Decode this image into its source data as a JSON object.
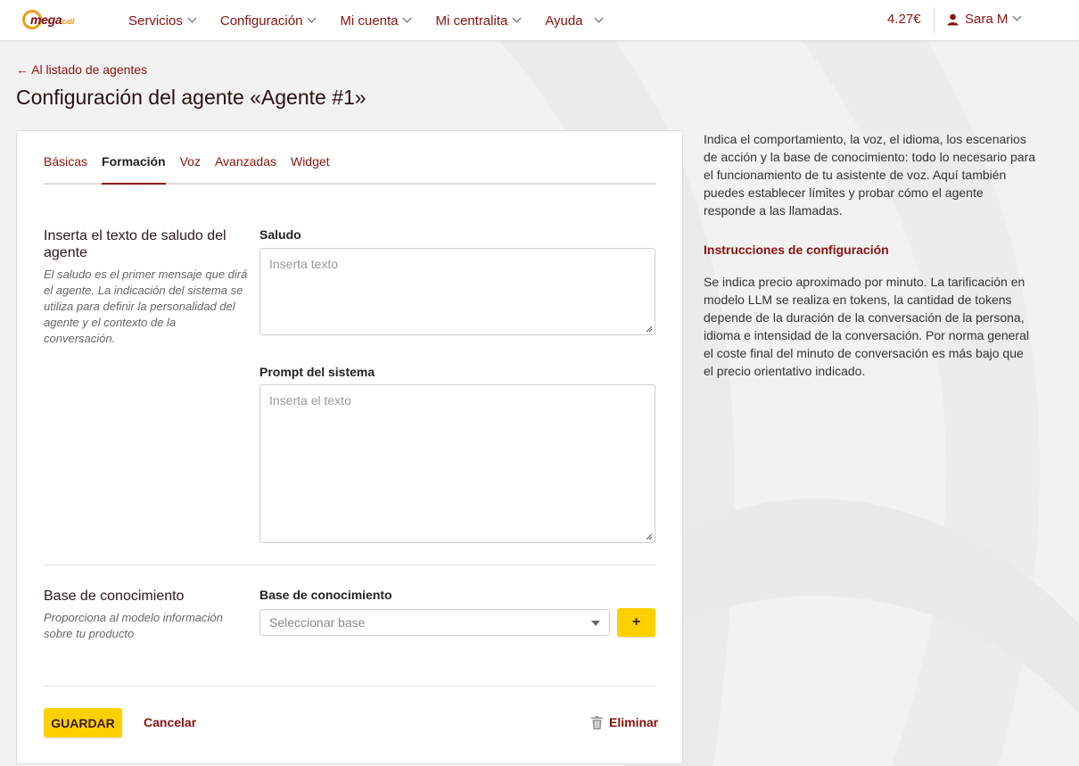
{
  "brand": {
    "name": "mega",
    "suffix": "call"
  },
  "nav": {
    "items": [
      {
        "label": "Servicios"
      },
      {
        "label": "Configuración"
      },
      {
        "label": "Mi cuenta"
      },
      {
        "label": "Mi centralita"
      },
      {
        "label": "Ayuda"
      }
    ],
    "balance": "4.27€",
    "user_name": "Sara M"
  },
  "page": {
    "back_link": "← Al listado de agentes",
    "title": "Configuración del agente «Agente #1»"
  },
  "tabs": [
    {
      "label": "Básicas",
      "active": false
    },
    {
      "label": "Formación",
      "active": true
    },
    {
      "label": "Voz",
      "active": false
    },
    {
      "label": "Avanzadas",
      "active": false
    },
    {
      "label": "Widget",
      "active": false
    }
  ],
  "greeting_section": {
    "title": "Inserta el texto de saludo del agente",
    "description": "El saludo es el primer mensaje que dirá el agente. La indicación del sistema se utiliza para definir la personalidad del agente y el contexto de la conversación.",
    "greeting_label": "Saludo",
    "greeting_placeholder": "Inserta texto",
    "greeting_value": "",
    "prompt_label": "Prompt del sistema",
    "prompt_placeholder": "Inserta el texto",
    "prompt_value": ""
  },
  "knowledge_section": {
    "title": "Base de conocimiento",
    "description": "Proporciona al modelo información sobre tu producto",
    "field_label": "Base de conocimiento",
    "select_placeholder": "Seleccionar base",
    "add_label": "+"
  },
  "actions": {
    "save_label": "GUARDAR",
    "cancel_label": "Cancelar",
    "delete_label": "Eliminar"
  },
  "aside": {
    "intro": "Indica el comportamiento, la voz, el idioma, los escenarios de acción y la base de conocimiento: todo lo necesario para el funcionamiento de tu asistente de voz. Aquí también puedes establecer límites y probar cómo el agente responde a las llamadas.",
    "heading": "Instrucciones de configuración",
    "body": "Se indica precio aproximado por minuto. La tarificación en modelo LLM se realiza en tokens, la cantidad de tokens depende de la duración de la conversación de la persona, idioma e intensidad de la conversación. Por norma general el coste final del minuto de conversación es más bajo que el precio orientativo indicado."
  },
  "colors": {
    "accent": "#8b1010",
    "button": "#ffd000",
    "background": "#f2f2f2"
  }
}
